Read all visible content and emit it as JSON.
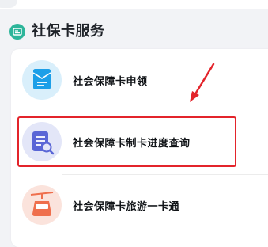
{
  "section": {
    "title": "社保卡服务",
    "icon": "card-icon"
  },
  "services": [
    {
      "label": "社会保障卡申领",
      "icon": "application-form-icon"
    },
    {
      "label": "社会保障卡制卡进度查询",
      "icon": "progress-search-icon"
    },
    {
      "label": "社会保障卡旅游一卡通",
      "icon": "cable-car-icon"
    }
  ],
  "colors": {
    "accent_green": "#2db59a",
    "highlight_red": "#e3242b",
    "icon_blue": "#1c9fe8",
    "icon_purple": "#5a66d6",
    "icon_orange": "#ef6f4d"
  }
}
